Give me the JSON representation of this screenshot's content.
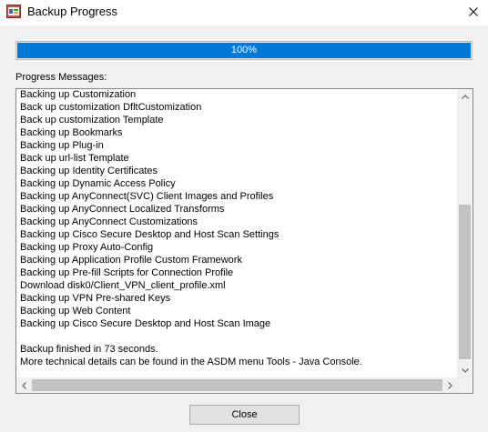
{
  "window": {
    "title": "Backup Progress",
    "close_icon": "close-icon",
    "app_icon": "asdm-app-icon"
  },
  "progress": {
    "value": 1.0,
    "label": "100%",
    "color": "#0078d7"
  },
  "messages": {
    "label": "Progress Messages:",
    "lines": [
      "Backing up Customization",
      "Back up customization DfltCustomization",
      "Back up customization Template",
      "Backing up Bookmarks",
      "Backing up Plug-in",
      "Back up url-list Template",
      "Backing up Identity Certificates",
      "Backing up Dynamic Access Policy",
      "Backing up AnyConnect(SVC) Client Images and Profiles",
      "Backing up AnyConnect Localized Transforms",
      "Backing up AnyConnect Customizations",
      "Backing up Cisco Secure Desktop and Host Scan Settings",
      "Backing up Proxy Auto-Config",
      "Backing up Application Profile Custom Framework",
      "Backing up Pre-fill Scripts for Connection Profile",
      "Download disk0/Client_VPN_client_profile.xml",
      "Backing up VPN Pre-shared Keys",
      "Backing up Web Content",
      "Backing up Cisco Secure Desktop and Host Scan Image",
      "",
      "Backup finished in 73 seconds.",
      "More technical details can be found in the ASDM menu Tools - Java Console."
    ]
  },
  "buttons": {
    "close_label": "Close"
  }
}
